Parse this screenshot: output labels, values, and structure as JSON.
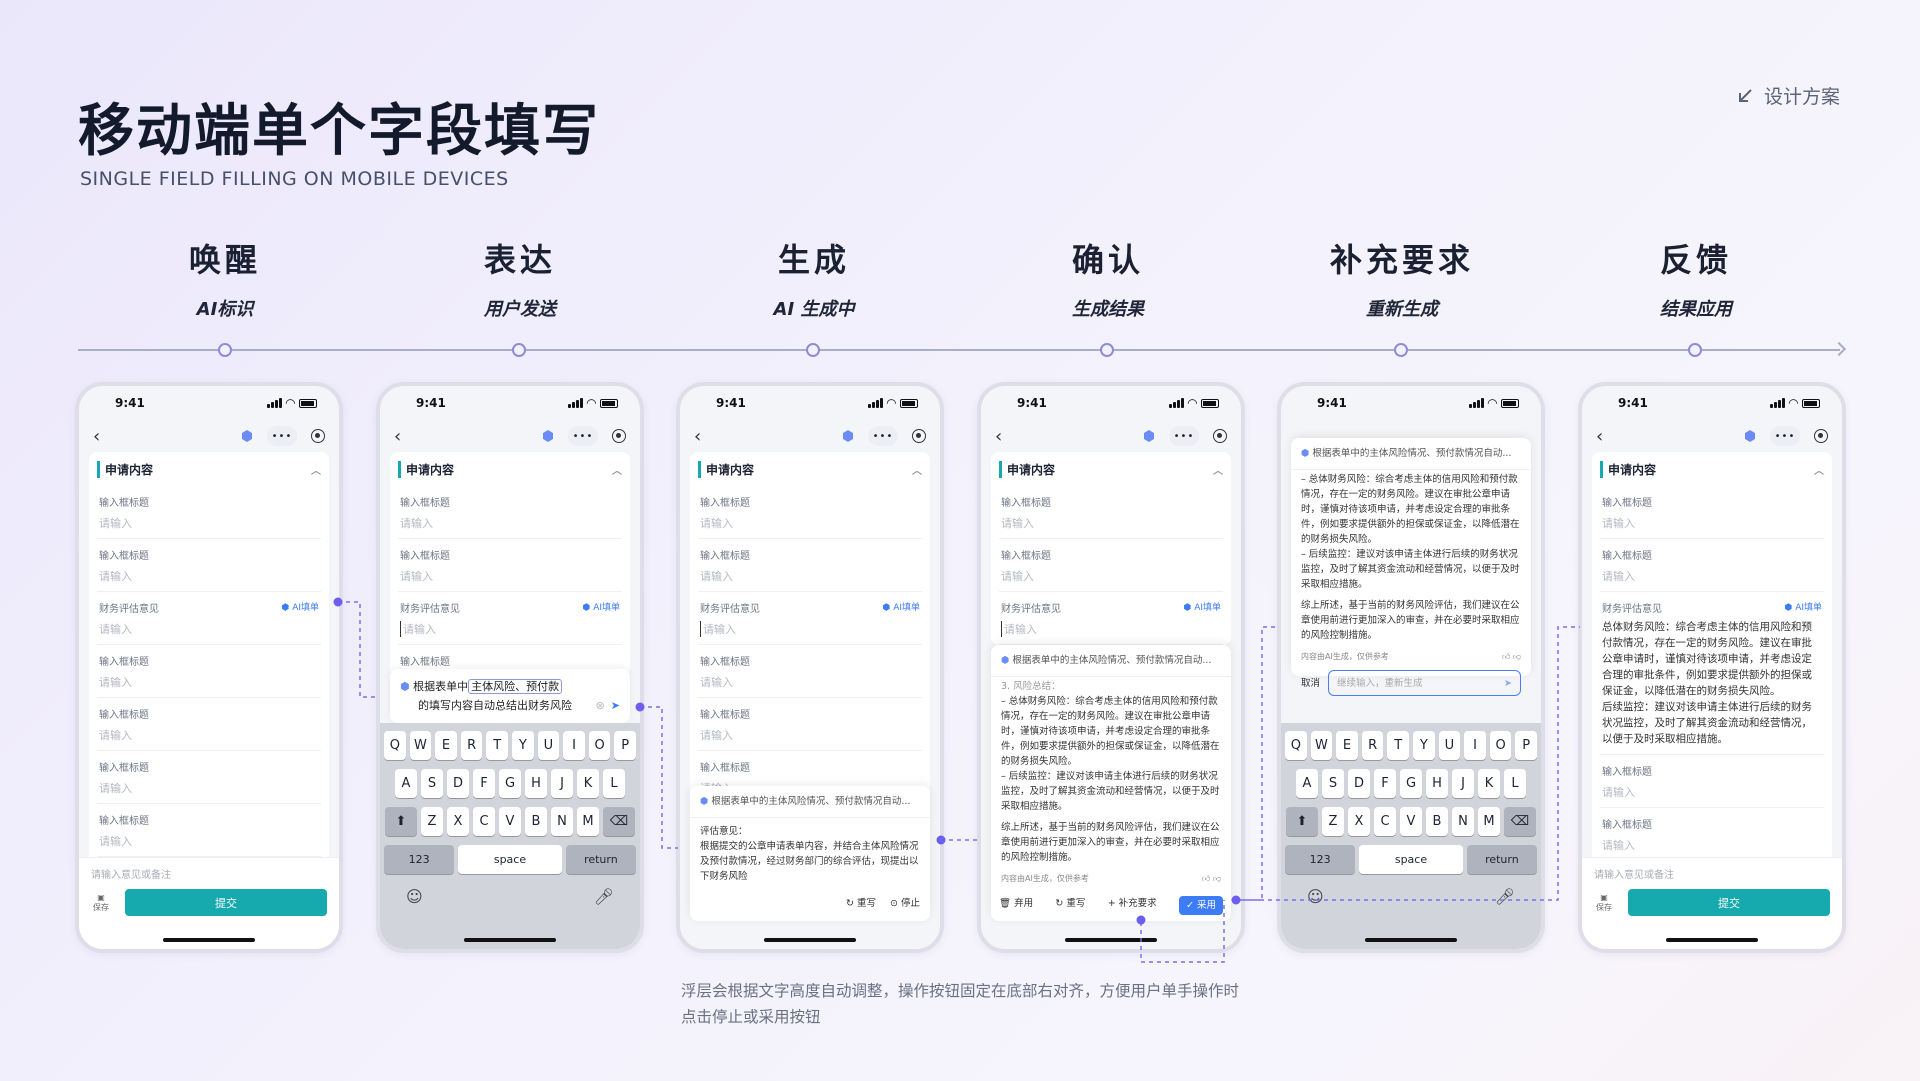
{
  "header": {
    "title": "移动端单个字段填写",
    "subtitle": "SINGLE FIELD FILLING ON MOBILE DEVICES",
    "link_label": "设计方案"
  },
  "steps": [
    {
      "heading": "唤醒",
      "sub": "AI标识"
    },
    {
      "heading": "表达",
      "sub": "用户发送"
    },
    {
      "heading": "生成",
      "sub": "AI 生成中"
    },
    {
      "heading": "确认",
      "sub": "生成结果"
    },
    {
      "heading": "补充要求",
      "sub": "重新生成"
    },
    {
      "heading": "反馈",
      "sub": "结果应用"
    }
  ],
  "phone": {
    "time": "9:41",
    "section": "申请内容",
    "field_label": "输入框标题",
    "placeholder": "请输入",
    "assess_label": "财务评估意见",
    "ai_tag": "AI填单",
    "remark": "请输入意见或备注",
    "save": "保存",
    "submit": "提交"
  },
  "keyboard": {
    "row1": [
      "Q",
      "W",
      "E",
      "R",
      "T",
      "Y",
      "U",
      "I",
      "O",
      "P"
    ],
    "row2": [
      "A",
      "S",
      "D",
      "F",
      "G",
      "H",
      "J",
      "K",
      "L"
    ],
    "row3": [
      "Z",
      "X",
      "C",
      "V",
      "B",
      "N",
      "M"
    ],
    "num": "123",
    "space": "space",
    "ret": "return"
  },
  "prompt": {
    "pre": "根据表单中",
    "hl": "主体风险、预付款",
    "post": "的填写内容自动总结出财务风险"
  },
  "generating": {
    "header": "根据表单中的主体风险情况、预付款情况自动...",
    "label": "评估意见：",
    "text": "根据提交的公章申请表单内容，并结合主体风险情况及预付款情况，经过财务部门的综合评估，现提出以下财务风险",
    "rewrite": "重写",
    "stop": "停止"
  },
  "result": {
    "header": "根据表单中的主体风险情况、预付款情况自动...",
    "top": "3. 风险总结：",
    "p1": "– 总体财务风险：综合考虑主体的信用风险和预付款情况，存在一定的财务风险。建议在审批公章申请时，谨慎对待该项申请，并考虑设定合理的审批条件，例如要求提供额外的担保或保证金，以降低潜在的财务损失风险。",
    "p2": "– 后续监控：建议对该申请主体进行后续的财务状况监控，及时了解其资金流动和经营情况，以便于及时采取相应措施。",
    "p3": "综上所述，基于当前的财务风险评估，我们建议在公章使用前进行更加深入的审查，并在必要时采取相应的风险控制措施。",
    "note": "内容由AI生成，仅供参考",
    "discard": "弃用",
    "rewrite": "重写",
    "supplement": "+ 补充要求",
    "use": "采用"
  },
  "refine": {
    "cancel": "取消",
    "placeholder": "继续输入，重新生成"
  },
  "final_text": "总体财务风险：综合考虑主体的信用风险和预付款情况，存在一定的财务风险。建议在审批公章申请时，谨慎对待该项申请，并考虑设定合理的审批条件，例如要求提供额外的担保或保证金，以降低潜在的财务损失风险。\n后续监控：建议对该申请主体进行后续的财务状况监控，及时了解其资金流动和经营情况，以便于及时采取相应措施。",
  "caption": "浮层会根据文字高度自动调整，操作按钮固定在底部右对齐，方便用户单手操作时点击停止或采用按钮",
  "colors": {
    "accent": "#16a9ad",
    "ai_blue": "#3d7cf5",
    "connector": "#7b6ff0"
  }
}
